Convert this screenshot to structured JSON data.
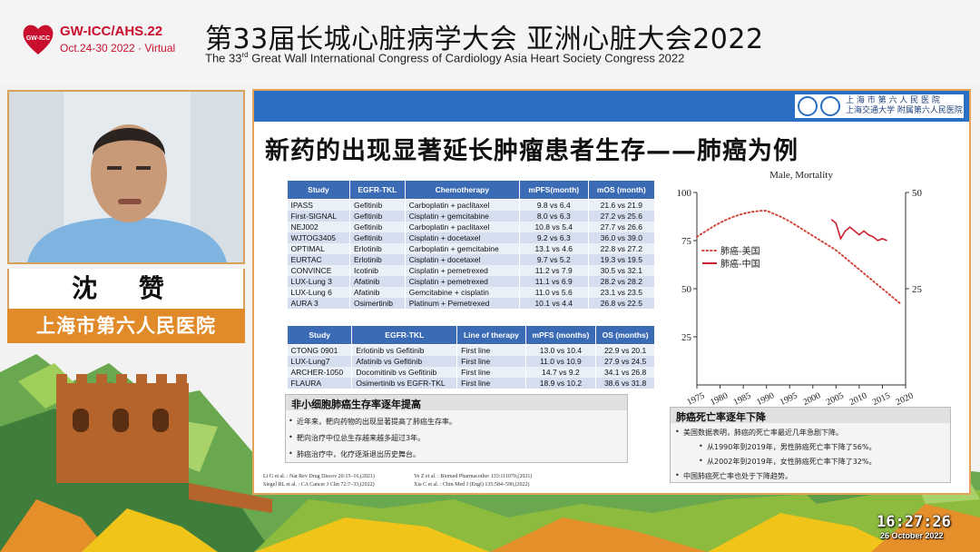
{
  "header": {
    "logo_line1": "GW-ICC/AHS.22",
    "logo_line2": "Oct.24-30 2022 · Virtual",
    "logo_badge": "GW-ICC",
    "title_cn": "第33届长城心脏病学大会  亚洲心脏大会2022",
    "title_en_pre": "The 33",
    "title_en_sup": "rd",
    "title_en_post": " Great Wall International Congress of Cardiology    Asia Heart Society Congress 2022"
  },
  "speaker": {
    "name": "沈 赞",
    "hospital": "上海市第六人民医院"
  },
  "slide": {
    "institution_line1": "上 海 市 第 六 人 民 医 院",
    "institution_line2": "上海交通大学  附属第六人民医院",
    "title": "新药的出现显著延长肿瘤患者生存——肺癌为例",
    "table1": {
      "headers": [
        "Study",
        "EGFR-TKL",
        "Chemotherapy",
        "mPFS(month)",
        "mOS (month)"
      ],
      "rows": [
        [
          "IPASS",
          "Gefitinib",
          "Carboplatin + paclitaxel",
          "9.8 vs 6.4",
          "21.6 vs 21.9"
        ],
        [
          "First-SIGNAL",
          "Gefitinib",
          "Cisplatin + gemcitabine",
          "8.0 vs 6.3",
          "27.2 vs 25.6"
        ],
        [
          "NEJ002",
          "Gefitinib",
          "Carboplatin + paclitaxel",
          "10.8 vs 5.4",
          "27.7 vs 26.6"
        ],
        [
          "WJTOG3405",
          "Gefitinib",
          "Cisplatin + docetaxel",
          "9.2 vs 6.3",
          "36.0 vs 39.0"
        ],
        [
          "OPTIMAL",
          "Erlotinib",
          "Carboplatin + gemcitabine",
          "13.1 vs 4.6",
          "22.8 vs 27.2"
        ],
        [
          "EURTAC",
          "Erlotinib",
          "Cisplatin + docetaxel",
          "9.7 vs 5.2",
          "19.3 vs 19.5"
        ],
        [
          "CONVINCE",
          "Icotinib",
          "Cisplatin + pemetrexed",
          "11.2 vs 7.9",
          "30.5 vs 32.1"
        ],
        [
          "LUX-Lung 3",
          "Afatinib",
          "Cisplatin + pemetrexed",
          "11.1 vs 6.9",
          "28.2 vs 28.2"
        ],
        [
          "LUX-Lung 6",
          "Afatinib",
          "Gemcitabine + cisplatin",
          "11.0 vs 5.6",
          "23.1 vs 23.5"
        ],
        [
          "AURA 3",
          "Osimertinib",
          "Platinum + Pemetrexed",
          "10.1 vs 4.4",
          "26.8 vs 22.5"
        ]
      ]
    },
    "table2": {
      "headers": [
        "Study",
        "EGFR-TKL",
        "Line of therapy",
        "mPFS (months)",
        "OS (months)"
      ],
      "rows": [
        [
          "CTONG 0901",
          "Erlotinib vs Gefitinib",
          "First line",
          "13.0 vs 10.4",
          "22.9 vs 20.1"
        ],
        [
          "LUX-Lung7",
          "Afatinib vs Gefitinib",
          "First line",
          "11.0 vs 10.9",
          "27.9 vs 24.5"
        ],
        [
          "ARCHER-1050",
          "Docomitinib vs Gefitinib",
          "First line",
          "14.7 vs 9.2",
          "34.1 vs 26.8"
        ],
        [
          "FLAURA",
          "Osimertinib vs EGFR-TKL",
          "First line",
          "18.9 vs 10.2",
          "38.6 vs 31.8"
        ]
      ]
    },
    "left_note": {
      "title": "非小细胞肺癌生存率逐年提高",
      "items": [
        "近年来，靶向药物的出现显著提高了肺癌生存率。",
        "靶向治疗中位总生存越来越多超过3年。",
        "肺癌治疗中，化疗逐渐退出历史舞台。"
      ]
    },
    "refs": [
      "Li G et al. : Nat Rev Drug Discov 20:15–16,(2021)",
      "Siegel RL et al. : CA Cancer J Clin 72:7–33,(2022)",
      "Ye Z et al. : Biomed Pharmacother 133:111079,(2021)",
      "Xia C et al. : Chin Med J (Engl) 135:584–590,(2022)"
    ],
    "right_note": {
      "title": "肺癌死亡率逐年下降",
      "items": [
        "美国数据表明，肺癌的死亡率最近几年急剧下降。",
        "从1990年到2019年，男性肺癌死亡率下降了56%。",
        "从2002年到2019年，女性肺癌死亡率下降了32%。",
        "中国肺癌死亡率也处于下降趋势。"
      ]
    }
  },
  "chart_data": {
    "type": "line",
    "title": "Male, Mortality",
    "xlabel": "",
    "ylabel": "",
    "x_ticks": [
      "1975",
      "1980",
      "1985",
      "1990",
      "1995",
      "2000",
      "2005",
      "2010",
      "2015",
      "2020"
    ],
    "xlim": [
      1975,
      2020
    ],
    "ylim_left": [
      0,
      100
    ],
    "yticks_left": [
      "25",
      "50",
      "75",
      "100"
    ],
    "ylim_right": [
      0,
      50
    ],
    "yticks_right": [
      "25",
      "50"
    ],
    "legend_position": "left-middle",
    "series": [
      {
        "name": "肺癌-美国",
        "axis": "left",
        "style": "dotted",
        "color": "#d2453a",
        "x": [
          1975,
          1977,
          1979,
          1981,
          1983,
          1985,
          1987,
          1989,
          1990,
          1991,
          1993,
          1995,
          1997,
          1999,
          2001,
          2003,
          2005,
          2007,
          2009,
          2011,
          2013,
          2015,
          2017,
          2019
        ],
        "y": [
          77,
          80,
          83,
          85.5,
          87.5,
          89,
          90,
          90.5,
          90.5,
          89.5,
          87.5,
          85,
          82,
          79,
          76,
          73,
          70,
          66,
          62,
          58,
          54,
          50,
          46,
          42
        ]
      },
      {
        "name": "肺癌-中国",
        "axis": "right",
        "style": "solid",
        "color": "#c8202e",
        "x": [
          2004,
          2005,
          2006,
          2007,
          2008,
          2009,
          2010,
          2011,
          2012,
          2013,
          2014,
          2015,
          2016
        ],
        "y": [
          43,
          42,
          38,
          40,
          41,
          40,
          39,
          40,
          39,
          38.5,
          37.5,
          38,
          37.5
        ]
      }
    ]
  },
  "clock": {
    "time": "16:27:26",
    "date": "26 October 2022"
  },
  "colors": {
    "brand_red": "#c8102e",
    "slide_blue": "#2a6fc4",
    "table_header": "#3b6bb5",
    "frame_orange": "#e4a25a",
    "hospital_orange": "#e08a2a"
  }
}
